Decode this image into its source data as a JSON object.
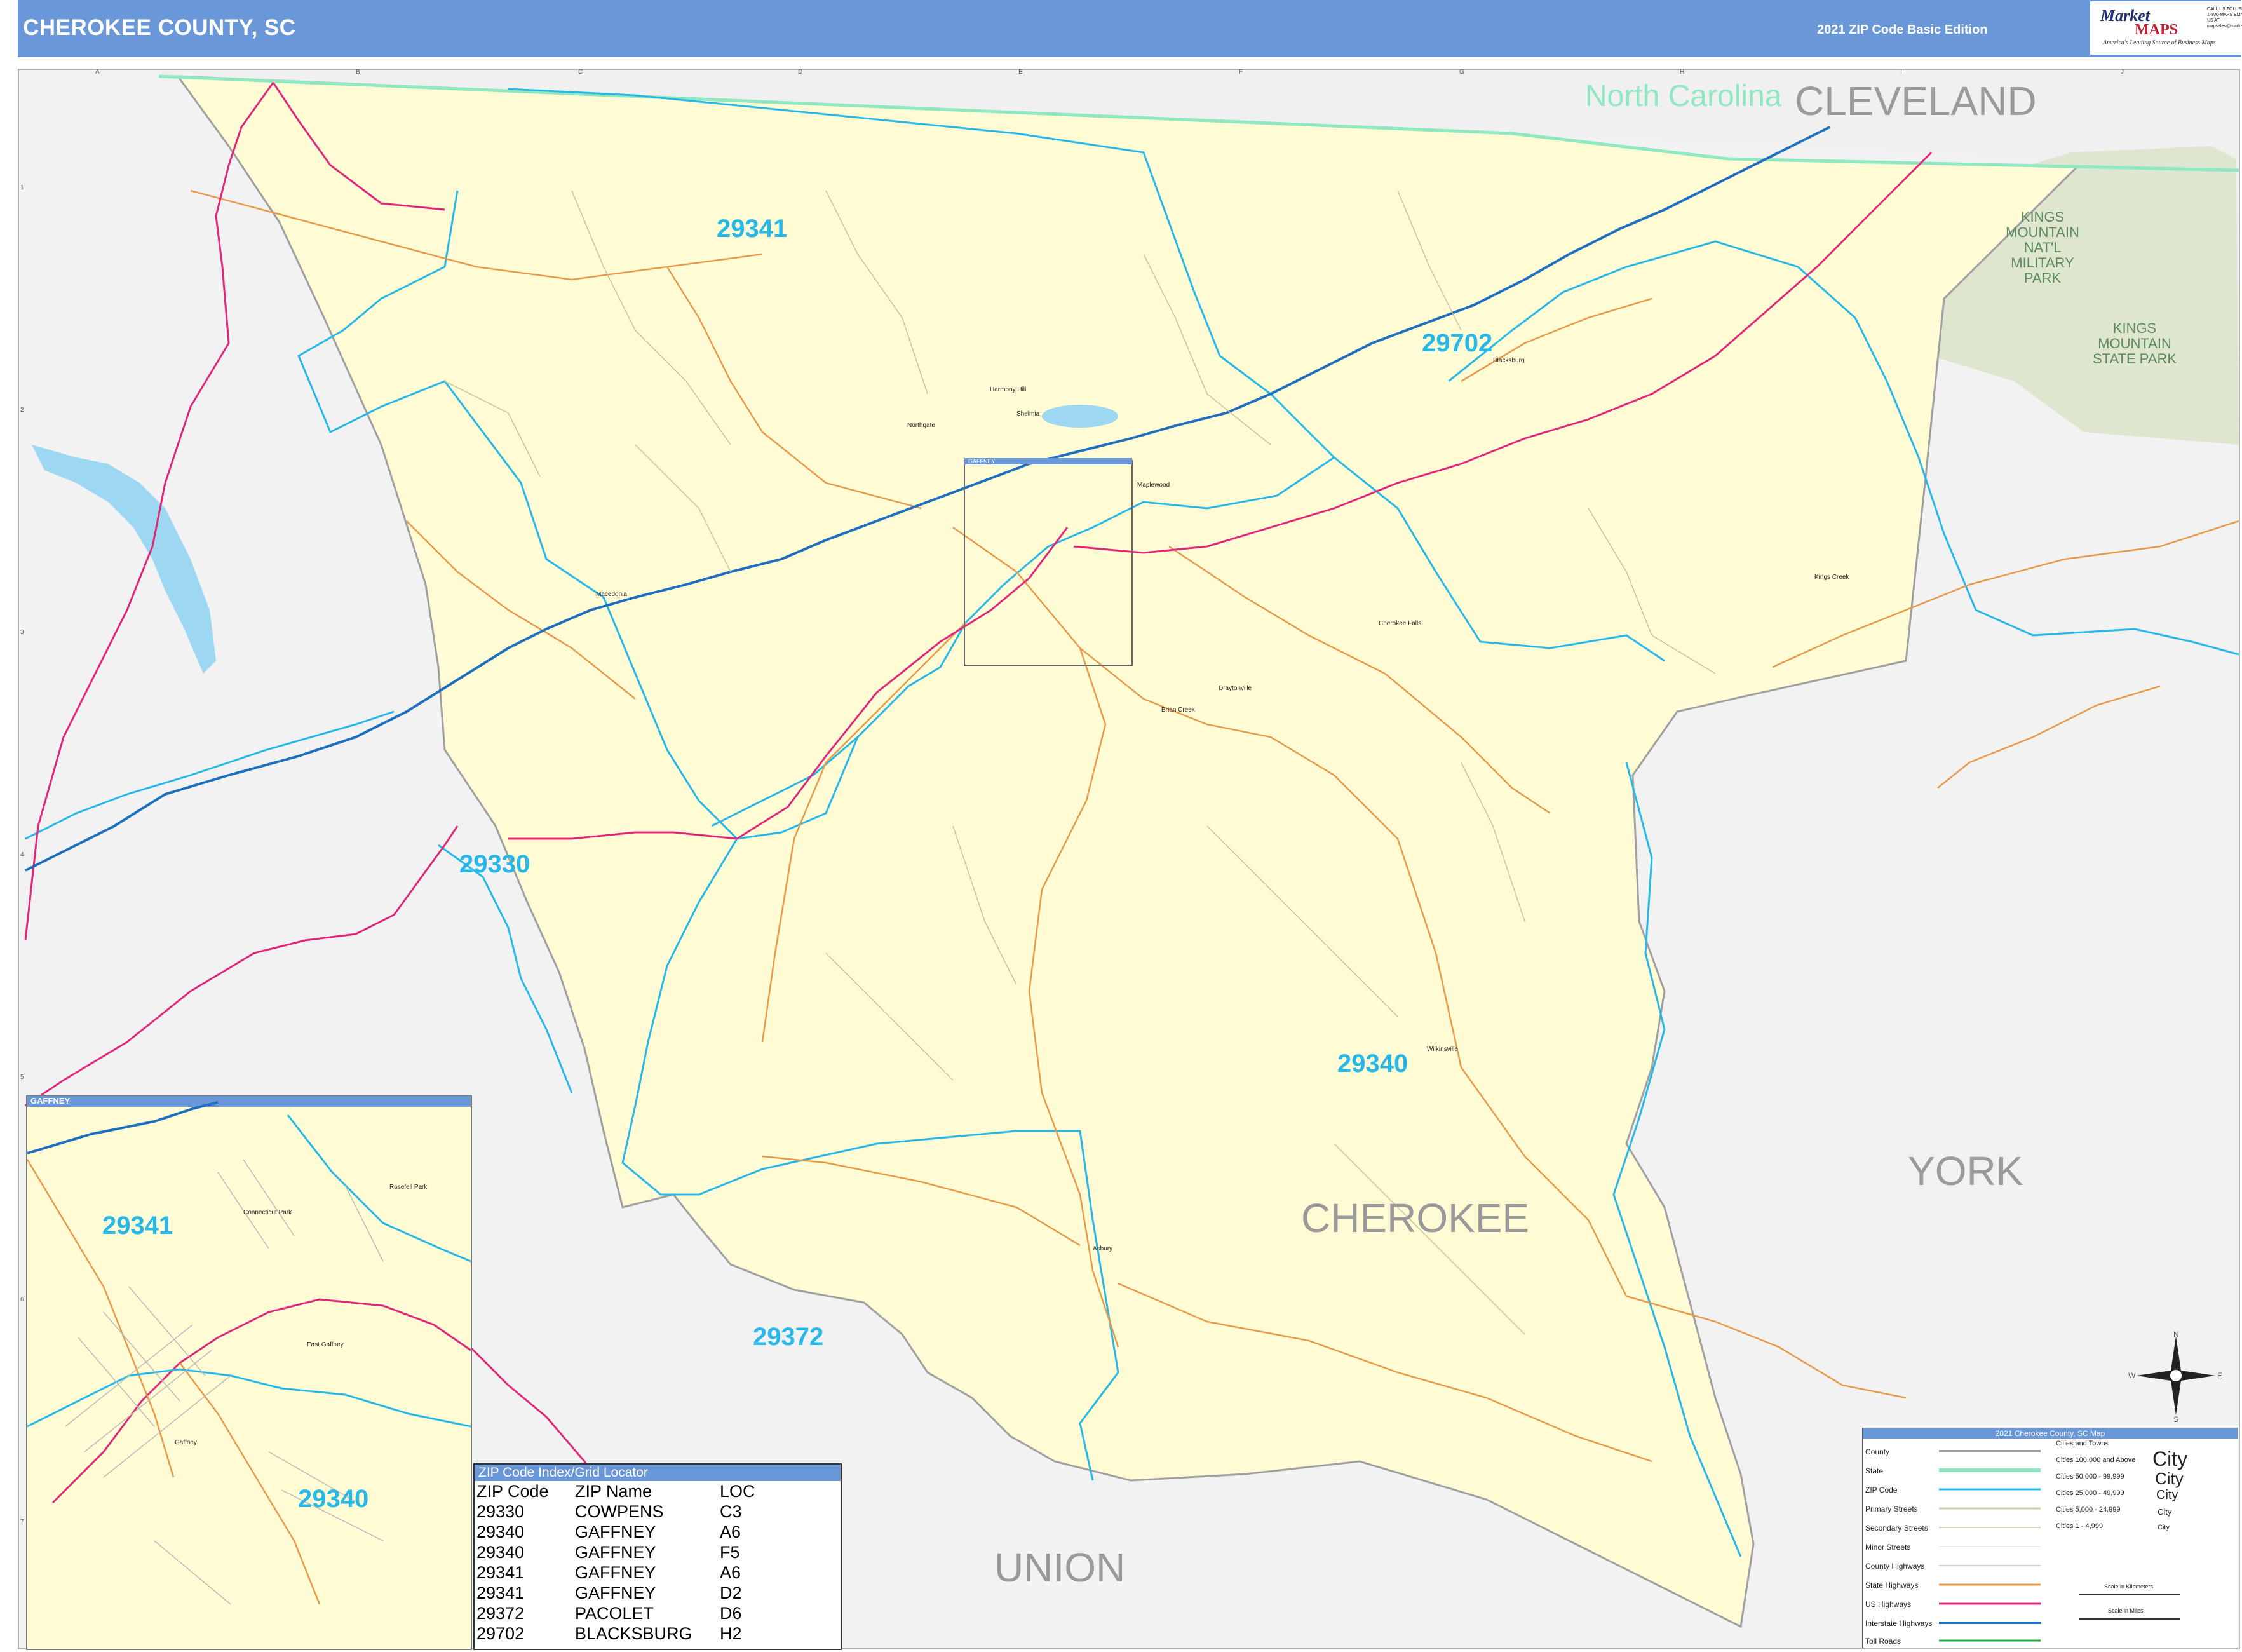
{
  "header": {
    "title": "CHEROKEE COUNTY, SC",
    "edition": "2021 ZIP Code Basic Edition",
    "logo_brand": "Market",
    "logo_brand2": "MAPS",
    "logo_tagline": "America's Leading Source of Business Maps",
    "logo_contact": "CALL US TOLL FREE 1-800-MAPS EMAIL US AT mapsales@marketmaps.com"
  },
  "colors": {
    "header_bar": "#6a97d8",
    "county_fill": "#fffbd5",
    "outside_fill": "#f2f2f2",
    "zip_boundary": "#27b8e8",
    "state_boundary": "#8fe8bf",
    "interstate": "#1f6fbf",
    "us_highway": "#e0287a",
    "state_highway": "#e79a4a",
    "park_fill": "#dfe6cf",
    "water": "#9dd7f2"
  },
  "map": {
    "counties": [
      "CLEVELAND",
      "YORK",
      "CHEROKEE",
      "UNION"
    ],
    "state": "North Carolina",
    "zip_labels": [
      "29341",
      "29702",
      "29330",
      "29340",
      "29372"
    ],
    "parks": [
      "KINGS MOUNTAIN NAT'L MILITARY PARK",
      "KINGS MOUNTAIN STATE PARK"
    ],
    "places": [
      "Harmony Hill",
      "Shelmia",
      "Northgate",
      "Maplewood",
      "Macedonia",
      "Blacksburg",
      "Kings Creek",
      "Cherokee Falls",
      "Draytonville",
      "Brian Creek",
      "Wilkinsville",
      "Asbury",
      "GAFFNEY"
    ],
    "grid_cols": [
      "A",
      "B",
      "C",
      "D",
      "E",
      "F",
      "G",
      "H",
      "I",
      "J"
    ],
    "grid_rows": [
      "1",
      "2",
      "3",
      "4",
      "5",
      "6",
      "7"
    ]
  },
  "inset": {
    "title": "GAFFNEY",
    "zip_labels": [
      "29341",
      "29340"
    ],
    "places": [
      "Connecticut Park",
      "Rosefell Park",
      "East Gaffney",
      "Gaffney"
    ]
  },
  "index": {
    "title": "ZIP Code Index/Grid Locator",
    "columns": [
      "ZIP Code",
      "ZIP Name",
      "LOC"
    ],
    "rows": [
      [
        "29330",
        "COWPENS",
        "C3"
      ],
      [
        "29340",
        "GAFFNEY",
        "A6"
      ],
      [
        "29340",
        "GAFFNEY",
        "F5"
      ],
      [
        "29341",
        "GAFFNEY",
        "A6"
      ],
      [
        "29341",
        "GAFFNEY",
        "D2"
      ],
      [
        "29372",
        "PACOLET",
        "D6"
      ],
      [
        "29702",
        "BLACKSBURG",
        "H2"
      ]
    ]
  },
  "legend": {
    "title": "2021 Cherokee County, SC Map",
    "items": [
      "County",
      "State",
      "ZIP Code",
      "Primary Streets",
      "Secondary Streets",
      "Minor Streets",
      "County Highways",
      "State Highways",
      "US Highways",
      "Interstate Highways",
      "Toll Roads"
    ],
    "city_header": "Cities and Towns",
    "city_ranges": [
      "Cities 100,000 and Above",
      "Cities 50,000 - 99,999",
      "Cities 25,000 - 49,999",
      "Cities 5,000 - 24,999",
      "Cities 1 - 4,999"
    ],
    "city_word": "City",
    "scale_km": "Scale in Kilometers",
    "scale_mi": "Scale in Miles"
  },
  "compass": {
    "n": "N",
    "s": "S",
    "e": "E",
    "w": "W"
  }
}
